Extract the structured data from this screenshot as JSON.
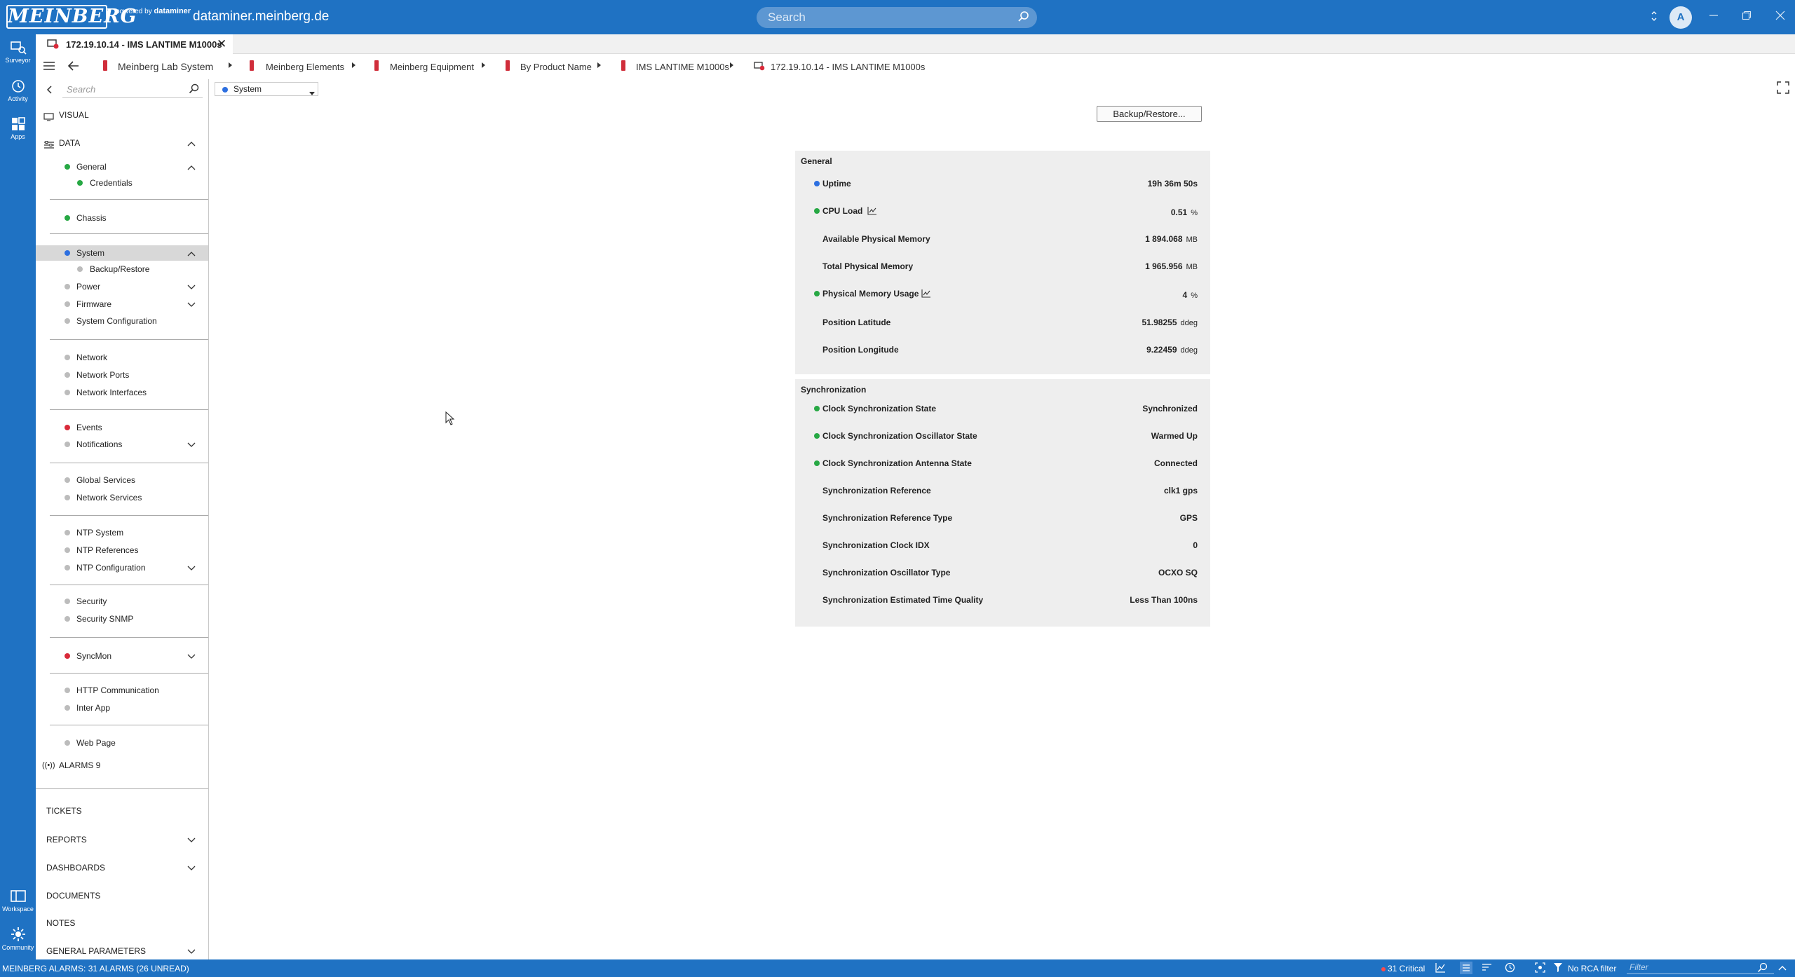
{
  "topbar": {
    "brand": "MEINBERG",
    "powered_by": "powered by",
    "powered_brand": "dataminer",
    "host": "dataminer.meinberg.de",
    "search_placeholder": "Search",
    "avatar_letter": "A"
  },
  "rail": {
    "items": [
      {
        "label": "Surveyor",
        "icon": "surveyor-icon"
      },
      {
        "label": "Activity",
        "icon": "activity-icon"
      },
      {
        "label": "Apps",
        "icon": "apps-icon"
      },
      {
        "label": "Workspace",
        "icon": "workspace-icon"
      },
      {
        "label": "Community",
        "icon": "community-icon"
      }
    ]
  },
  "tab": {
    "title": "172.19.10.14 - IMS LANTIME M1000s"
  },
  "breadcrumb": [
    "Meinberg Lab System",
    "Meinberg Elements",
    "Meinberg Equipment",
    "By Product Name",
    "IMS LANTIME M1000s",
    "172.19.10.14 - IMS LANTIME M1000s"
  ],
  "sidebar": {
    "search_placeholder": "Search",
    "visual_label": "VISUAL",
    "data_label": "DATA",
    "items": {
      "general": "General",
      "credentials": "Credentials",
      "chassis": "Chassis",
      "system": "System",
      "backup_restore": "Backup/Restore",
      "power": "Power",
      "firmware": "Firmware",
      "system_configuration": "System Configuration",
      "network": "Network",
      "network_ports": "Network Ports",
      "network_interfaces": "Network Interfaces",
      "events": "Events",
      "notifications": "Notifications",
      "global_services": "Global Services",
      "network_services": "Network Services",
      "ntp_system": "NTP System",
      "ntp_references": "NTP References",
      "ntp_configuration": "NTP Configuration",
      "security": "Security",
      "security_snmp": "Security SNMP",
      "syncmon": "SyncMon",
      "http_communication": "HTTP Communication",
      "inter_app": "Inter App",
      "web_page": "Web Page"
    },
    "alarms_label": "ALARMS 9",
    "tickets_label": "TICKETS",
    "reports_label": "REPORTS",
    "dashboards_label": "DASHBOARDS",
    "documents_label": "DOCUMENTS",
    "notes_label": "NOTES",
    "general_parameters_label": "GENERAL PARAMETERS"
  },
  "content": {
    "page_selector": "System",
    "backup_button": "Backup/Restore...",
    "general": {
      "title": "General",
      "rows": [
        {
          "label": "Uptime",
          "value": "19h 36m 50s",
          "unit": ""
        },
        {
          "label": "CPU Load",
          "value": "0.51",
          "unit": "%"
        },
        {
          "label": "Available Physical Memory",
          "value": "1 894.068",
          "unit": "MB"
        },
        {
          "label": "Total Physical Memory",
          "value": "1 965.956",
          "unit": "MB"
        },
        {
          "label": "Physical Memory Usage",
          "value": "4",
          "unit": "%"
        },
        {
          "label": "Position Latitude",
          "value": "51.98255",
          "unit": "ddeg"
        },
        {
          "label": "Position Longitude",
          "value": "9.22459",
          "unit": "ddeg"
        }
      ]
    },
    "synchronization": {
      "title": "Synchronization",
      "rows": [
        {
          "label": "Clock Synchronization State",
          "value": "Synchronized"
        },
        {
          "label": "Clock Synchronization Oscillator State",
          "value": "Warmed Up"
        },
        {
          "label": "Clock Synchronization Antenna State",
          "value": "Connected"
        },
        {
          "label": "Synchronization Reference",
          "value": "clk1 gps"
        },
        {
          "label": "Synchronization Reference Type",
          "value": "GPS"
        },
        {
          "label": "Synchronization Clock IDX",
          "value": "0"
        },
        {
          "label": "Synchronization Oscillator Type",
          "value": "OCXO SQ"
        },
        {
          "label": "Synchronization Estimated Time Quality",
          "value": "Less Than 100ns"
        }
      ]
    }
  },
  "statusbar": {
    "alarms": "MEINBERG ALARMS: 31 ALARMS (26 UNREAD)",
    "critical": "31 Critical",
    "rca": "No RCA filter",
    "filter_placeholder": "Filter"
  },
  "colors": {
    "brand_blue": "#1f72c3",
    "status_green": "#27a844",
    "status_blue": "#2d6fe0",
    "status_red": "#d92a3a",
    "status_grey": "#bcbcbc"
  }
}
